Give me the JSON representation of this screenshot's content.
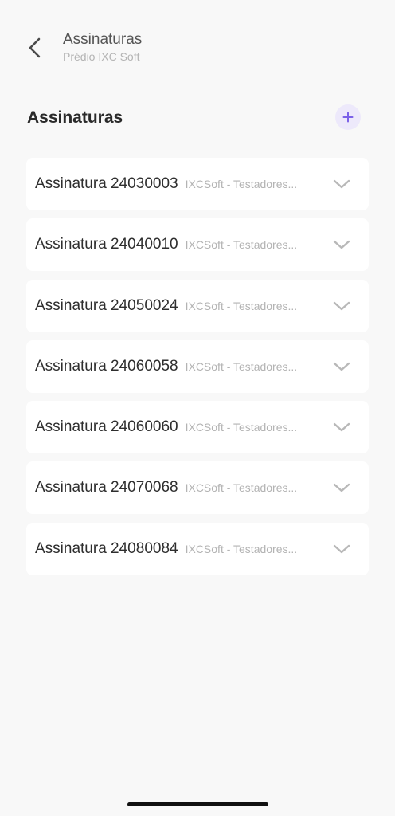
{
  "header": {
    "title": "Assinaturas",
    "subtitle": "Prédio IXC Soft",
    "back_icon": "chevron-left-icon"
  },
  "section": {
    "title": "Assinaturas",
    "add_icon": "plus-icon"
  },
  "subscriptions": [
    {
      "name": "Assinatura 24030003",
      "company": "IXCSoft - Testadores..."
    },
    {
      "name": "Assinatura 24040010",
      "company": "IXCSoft - Testadores..."
    },
    {
      "name": "Assinatura 24050024",
      "company": "IXCSoft - Testadores..."
    },
    {
      "name": "Assinatura 24060058",
      "company": "IXCSoft - Testadores..."
    },
    {
      "name": "Assinatura 24060060",
      "company": "IXCSoft - Testadores..."
    },
    {
      "name": "Assinatura 24070068",
      "company": "IXCSoft - Testadores..."
    },
    {
      "name": "Assinatura 24080084",
      "company": "IXCSoft - Testadores..."
    }
  ],
  "colors": {
    "accent": "#7b61e8",
    "accent_bg": "#ede9fb",
    "background": "#f8f8f8",
    "card": "#ffffff"
  }
}
